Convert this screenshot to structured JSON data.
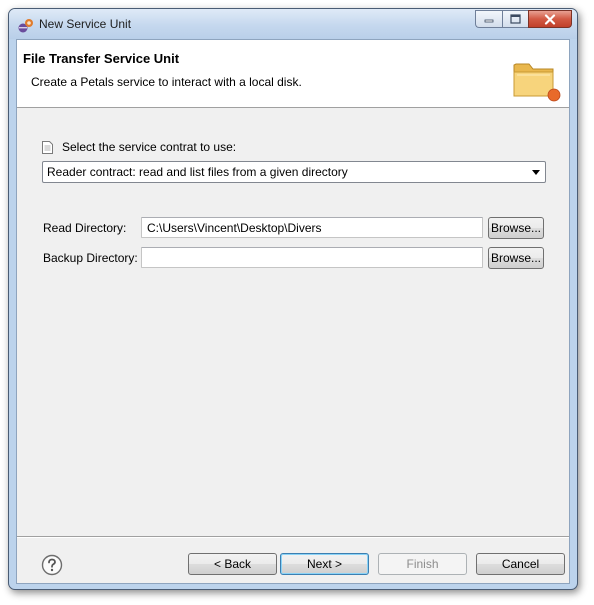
{
  "window": {
    "title": "New Service Unit"
  },
  "banner": {
    "title": "File Transfer Service Unit",
    "description": "Create a Petals service to interact with a local disk."
  },
  "contract": {
    "label": "Select the service contrat to use:",
    "selected": "Reader contract: read and list files from a given directory"
  },
  "fields": {
    "read_directory": {
      "label": "Read Directory:",
      "value": "C:\\Users\\Vincent\\Desktop\\Divers",
      "browse": "Browse..."
    },
    "backup_directory": {
      "label": "Backup Directory:",
      "value": "",
      "browse": "Browse..."
    }
  },
  "footer": {
    "back": "< Back",
    "next": "Next >",
    "finish": "Finish",
    "cancel": "Cancel"
  },
  "icons": {
    "app": "eclipse-app-icon",
    "window_controls": [
      "minimize-icon",
      "maximize-icon",
      "close-icon"
    ],
    "banner": "folder-icon",
    "contract": "document-icon",
    "help": "help-icon"
  },
  "colors": {
    "window_frame": "#bcd3ec",
    "close_button": "#c8452e",
    "dialog_background": "#f0f0f0",
    "default_button_border": "#3c7fb1"
  }
}
